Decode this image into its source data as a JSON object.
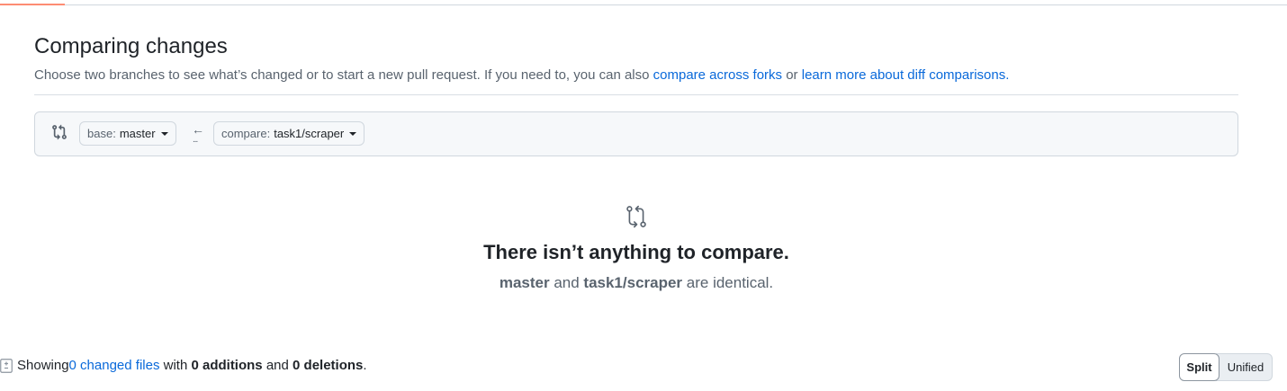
{
  "page": {
    "title": "Comparing changes",
    "description_prefix": "Choose two branches to see what’s changed or to start a new pull request. If you need to, you can also ",
    "compare_forks_link": "compare across forks",
    "description_or": " or ",
    "diff_comparisons_link": "learn more about diff comparisons."
  },
  "range": {
    "base_label": "base:",
    "base_branch": "master",
    "arrow": "←",
    "dots": "...",
    "compare_label": "compare:",
    "compare_branch": "task1/scraper"
  },
  "blankslate": {
    "title": "There isn’t anything to compare.",
    "branch_a": "master",
    "and_word": " and ",
    "branch_b": "task1/scraper",
    "suffix": " are identical."
  },
  "summary": {
    "showing": "Showing ",
    "changed_files_link": "0 changed files",
    "with_text": " with ",
    "additions": "0 additions",
    "and_text": " and ",
    "deletions": "0 deletions",
    "period": "."
  },
  "view_toggle": {
    "split_label": "Split",
    "unified_label": "Unified",
    "selected": "Split"
  },
  "colors": {
    "link": "#0969da",
    "accent_underline": "#fd8c73",
    "muted": "#59636e",
    "border": "#d0d7de"
  },
  "icons": [
    "git-compare-icon",
    "arrow-left-icon",
    "diff-icon",
    "caret-down-icon"
  ]
}
